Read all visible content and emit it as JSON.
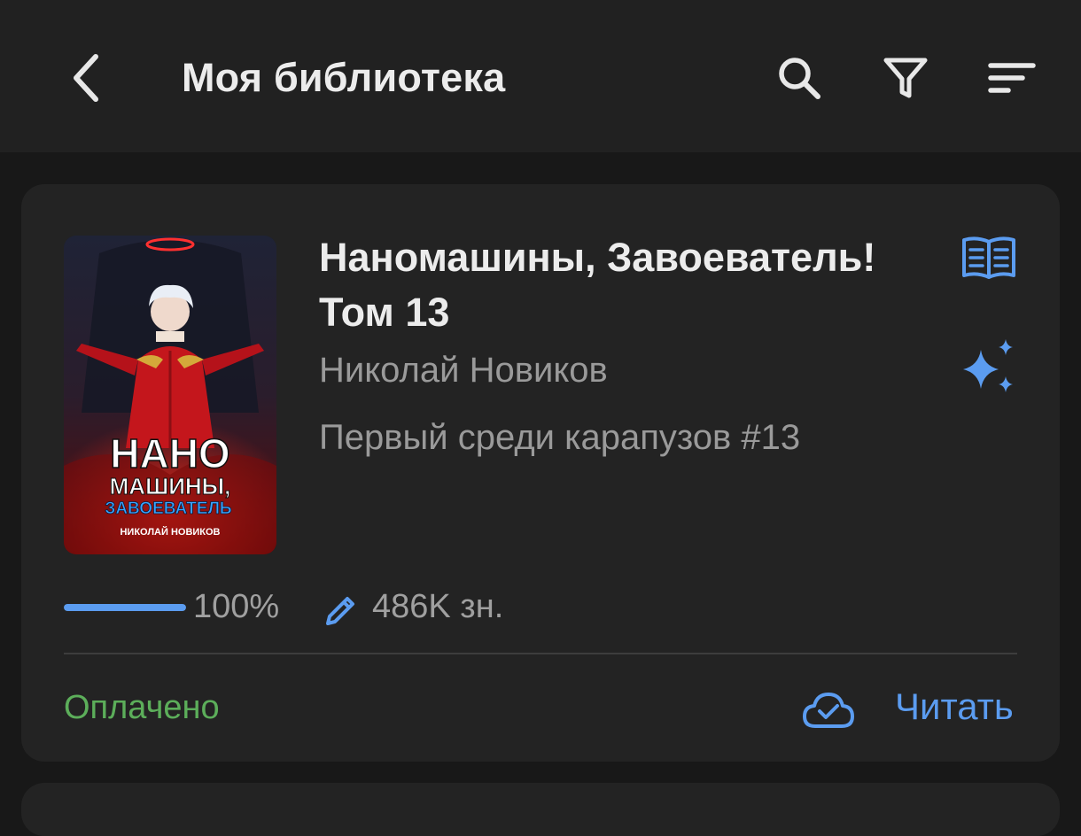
{
  "header": {
    "title": "Моя библиотека",
    "back_icon": "chevron-left-icon",
    "search_icon": "search-icon",
    "filter_icon": "filter-icon",
    "sort_icon": "sort-icon"
  },
  "book": {
    "title": "Наномашины, Завоеватель! Том 13",
    "author": "Николай Новиков",
    "series": "Первый среди карапузов #13",
    "cover": {
      "line1": "НАНО",
      "line2": "МАШИНЫ,",
      "line3": "ЗАВОЕВАТЕЛЬ",
      "author": "НИКОЛАЙ НОВИКОВ"
    },
    "progress_percent": 100,
    "progress_label": "100%",
    "chars_label": "486K зн.",
    "status": "Оплачено",
    "read_label": "Читать"
  },
  "colors": {
    "accent": "#5b9cf0",
    "paid": "#5cae5a",
    "background": "#181818",
    "card": "#232323",
    "appbar": "#212121"
  }
}
